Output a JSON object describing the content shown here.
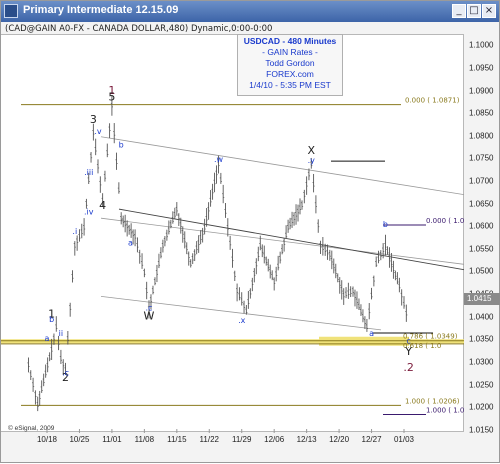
{
  "window": {
    "title": "Primary Intermediate 12.15.09",
    "symbol_line": "(CAD@GAIN A0-FX - CANADA DOLLAR,480) Dynamic,0:00-0:00"
  },
  "info_box": {
    "line1": "USDCAD - 480 Minutes",
    "line2": "- GAIN Rates -",
    "line3": "Todd Gordon",
    "line4": "FOREX.com",
    "line5": "1/4/10 - 5:35 PM EST"
  },
  "copyright": "© eSignal, 2009",
  "last_price": "1.0415",
  "chart_data": {
    "type": "ohlc",
    "series_name": "USDCAD",
    "timeframe": "480 Minutes",
    "x_ticks": [
      "10/18",
      "10/25",
      "11/01",
      "11/08",
      "11/15",
      "11/22",
      "11/29",
      "12/06",
      "12/13",
      "12/20",
      "12/27",
      "01/03"
    ],
    "y_ticks": [
      "1.1000",
      "1.0950",
      "1.0900",
      "1.0850",
      "1.0800",
      "1.0750",
      "1.0700",
      "1.0650",
      "1.0600",
      "1.0550",
      "1.0500",
      "1.0450",
      "1.0400",
      "1.0350",
      "1.0300",
      "1.0250",
      "1.0200",
      "1.0150"
    ],
    "ylim": [
      1.0145,
      1.1025
    ],
    "price_path": [
      {
        "date": "10/14",
        "price": 1.0296
      },
      {
        "date": "10/16",
        "price": 1.0208
      },
      {
        "date": "10/19",
        "price": 1.033
      },
      {
        "date": "10/20",
        "price": 1.038
      },
      {
        "date": "10/21",
        "price": 1.031
      },
      {
        "date": "10/22",
        "price": 1.0285
      },
      {
        "date": "10/24",
        "price": 1.056
      },
      {
        "date": "10/26",
        "price": 1.06
      },
      {
        "date": "10/28",
        "price": 1.081
      },
      {
        "date": "10/30",
        "price": 1.066
      },
      {
        "date": "11/01",
        "price": 1.087
      },
      {
        "date": "11/03",
        "price": 1.062
      },
      {
        "date": "11/06",
        "price": 1.058
      },
      {
        "date": "11/08",
        "price": 1.05
      },
      {
        "date": "11/09",
        "price": 1.042
      },
      {
        "date": "11/12",
        "price": 1.056
      },
      {
        "date": "11/15",
        "price": 1.064
      },
      {
        "date": "11/18",
        "price": 1.052
      },
      {
        "date": "11/21",
        "price": 1.06
      },
      {
        "date": "11/24",
        "price": 1.074
      },
      {
        "date": "11/26",
        "price": 1.06
      },
      {
        "date": "11/28",
        "price": 1.046
      },
      {
        "date": "11/30",
        "price": 1.0415
      },
      {
        "date": "12/03",
        "price": 1.056
      },
      {
        "date": "12/06",
        "price": 1.048
      },
      {
        "date": "12/09",
        "price": 1.06
      },
      {
        "date": "12/12",
        "price": 1.065
      },
      {
        "date": "12/14",
        "price": 1.074
      },
      {
        "date": "12/16",
        "price": 1.056
      },
      {
        "date": "12/18",
        "price": 1.054
      },
      {
        "date": "12/21",
        "price": 1.045
      },
      {
        "date": "12/23",
        "price": 1.046
      },
      {
        "date": "12/26",
        "price": 1.038
      },
      {
        "date": "12/28",
        "price": 1.052
      },
      {
        "date": "12/30",
        "price": 1.056
      },
      {
        "date": "01/02",
        "price": 1.047
      },
      {
        "date": "01/04",
        "price": 1.039
      }
    ],
    "fib_levels": [
      {
        "label": "0.000 ( 1.0871)",
        "price": 1.0871,
        "color": "#8a7a1e"
      },
      {
        "label": "0.000 ( 1.0",
        "price": 1.0605,
        "color": "#3a1a6e"
      },
      {
        "label": "0.786 ( 1.0349)",
        "price": 1.0349,
        "color": "#8a7a1e"
      },
      {
        "label": "0.618 ( 1.0",
        "price": 1.0342,
        "color": "#8a7a1e"
      },
      {
        "label": "1.000 ( 1.0206)",
        "price": 1.0206,
        "color": "#8a7a1e"
      },
      {
        "label": "1.000 ( 1.0",
        "price": 1.0186,
        "color": "#3a1a6e"
      }
    ],
    "wave_labels": [
      {
        "text": "1",
        "date": "11/01",
        "price": 1.0895,
        "color": "#7a1a3a"
      },
      {
        "text": "5",
        "date": "11/01",
        "price": 1.088,
        "color": "#222222"
      },
      {
        "text": "3",
        "date": "10/28",
        "price": 1.083,
        "color": "#222222"
      },
      {
        "text": "4",
        "date": "10/30",
        "price": 1.064,
        "color": "#222222"
      },
      {
        "text": "1",
        "date": "10/19",
        "price": 1.04,
        "color": "#222222"
      },
      {
        "text": "2",
        "date": "10/22",
        "price": 1.026,
        "color": "#222222"
      },
      {
        "text": "W",
        "date": "11/09",
        "price": 1.0396,
        "color": "#222222"
      },
      {
        "text": "X",
        "date": "12/14",
        "price": 1.0762,
        "color": "#222222"
      },
      {
        "text": "Y",
        "date": "01/04",
        "price": 1.0318,
        "color": "#222222"
      },
      {
        "text": ".2",
        "date": "01/04",
        "price": 1.0282,
        "color": "#7a1a3a"
      },
      {
        "text": "b",
        "date": "10/19",
        "price": 1.039,
        "color": "#1a3acc"
      },
      {
        "text": "a",
        "date": "10/18",
        "price": 1.0348,
        "color": "#1a3acc"
      },
      {
        "text": "ii",
        "date": "10/21",
        "price": 1.036,
        "color": "#1a3acc"
      },
      {
        "text": ".c",
        "date": "10/22",
        "price": 1.0272,
        "color": "#1a3acc"
      },
      {
        "text": ".i",
        "date": "10/24",
        "price": 1.0585,
        "color": "#1a3acc"
      },
      {
        "text": ".iii",
        "date": "10/27",
        "price": 1.0716,
        "color": "#1a3acc"
      },
      {
        "text": ".v",
        "date": "10/29",
        "price": 1.0806,
        "color": "#1a3acc"
      },
      {
        "text": ".iv",
        "date": "10/27",
        "price": 1.0628,
        "color": "#1a3acc"
      },
      {
        "text": "b",
        "date": "11/03",
        "price": 1.0776,
        "color": "#1a3acc"
      },
      {
        "text": "a",
        "date": "11/05",
        "price": 1.056,
        "color": "#1a3acc"
      },
      {
        "text": ".c",
        "date": "11/09",
        "price": 1.0416,
        "color": "#1a3acc"
      },
      {
        "text": ".w",
        "date": "11/24",
        "price": 1.0744,
        "color": "#1a3acc"
      },
      {
        "text": ".x",
        "date": "11/29",
        "price": 1.0388,
        "color": "#1a3acc"
      },
      {
        "text": ".y",
        "date": "12/14",
        "price": 1.0742,
        "color": "#1a3acc"
      },
      {
        "text": "b",
        "date": "12/30",
        "price": 1.06,
        "color": "#1a3acc"
      },
      {
        "text": "a",
        "date": "12/27",
        "price": 1.036,
        "color": "#1a3acc"
      },
      {
        "text": "c",
        "date": "01/04",
        "price": 1.0343,
        "color": "#1a3acc"
      }
    ]
  }
}
